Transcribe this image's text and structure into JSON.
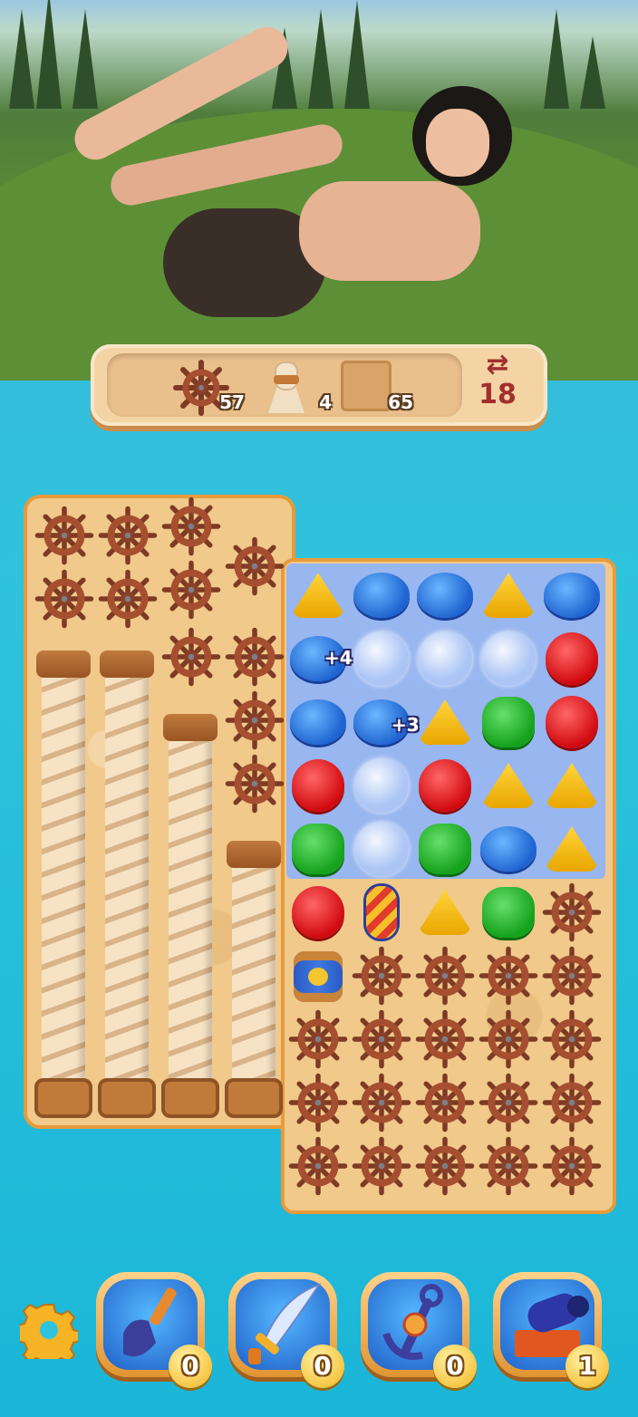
{
  "goals": {
    "wheel_count": "57",
    "rope_count": "4",
    "sand_count": "65"
  },
  "moves": {
    "arrows": "⇄",
    "count": "18"
  },
  "board": {
    "bonus_a": "+4",
    "bonus_b": "+3"
  },
  "boosters": {
    "shovel_count": "0",
    "sword_count": "0",
    "anchor_count": "0",
    "cannon_count": "1"
  },
  "colors": {
    "accent": "#e79b3b",
    "moves": "#a0302e"
  }
}
